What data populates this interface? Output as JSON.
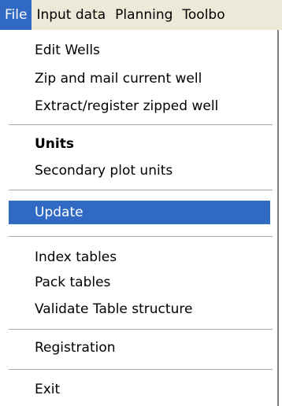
{
  "menubar": {
    "items": [
      "File",
      "Input data",
      "Planning",
      "Toolbo"
    ]
  },
  "menu": {
    "items": [
      "Edit Wells",
      "Zip and mail current well",
      "Extract/register zipped well",
      "Units",
      "Secondary plot units",
      "Update",
      "Index tables",
      "Pack tables",
      "Validate Table structure",
      "Registration",
      "Exit"
    ]
  },
  "colors": {
    "highlight": "#316ac5",
    "menubar_bg": "#ece9d8",
    "separator": "#aca899"
  }
}
